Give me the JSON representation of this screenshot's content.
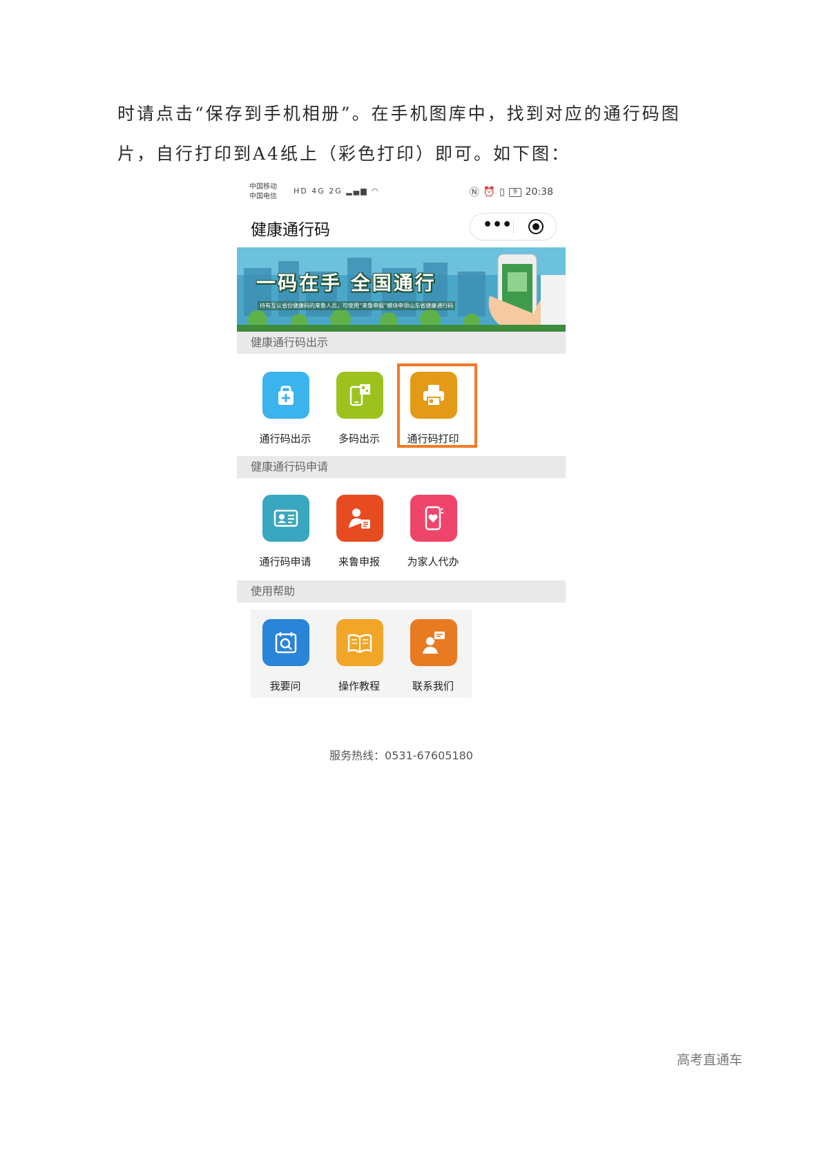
{
  "document": {
    "line1": "时请点击“保存到手机相册”。在手机图库中，找到对应的通行码图",
    "line2": "片，自行打印到A4纸上（彩色打印）即可。如下图："
  },
  "phone": {
    "statusbar": {
      "carrier1": "中国移动",
      "carrier2": "中国电信",
      "network_badges": "HD 4G 2G",
      "battery": "9",
      "time": "20:38"
    },
    "app_title": "健康通行码",
    "banner": {
      "slogan": "一码在手 全国通行",
      "subtext": "持有互认省份健康码的来鲁人员，可使用“来鲁申报”模块申领山东省健康通行码"
    },
    "sections": [
      {
        "title": "健康通行码出示",
        "items": [
          {
            "label": "通行码出示",
            "icon": "medical-kit-icon",
            "color": "#3bb4ee"
          },
          {
            "label": "多码出示",
            "icon": "phone-qr-icon",
            "color": "#9dc21e"
          },
          {
            "label": "通行码打印",
            "icon": "printer-icon",
            "color": "#e39a16",
            "highlighted": true
          }
        ]
      },
      {
        "title": "健康通行码申请",
        "items": [
          {
            "label": "通行码申请",
            "icon": "id-card-icon",
            "color": "#3aa7c0"
          },
          {
            "label": "来鲁申报",
            "icon": "person-form-icon",
            "color": "#e64c1f"
          },
          {
            "label": "为家人代办",
            "icon": "phone-heart-icon",
            "color": "#f0456a"
          }
        ]
      },
      {
        "title": "使用帮助",
        "items": [
          {
            "label": "我要问",
            "icon": "search-calendar-icon",
            "color": "#2a84d8"
          },
          {
            "label": "操作教程",
            "icon": "book-icon",
            "color": "#f2a628"
          },
          {
            "label": "联系我们",
            "icon": "contact-chat-icon",
            "color": "#e87a22"
          }
        ]
      }
    ],
    "hotline": "服务热线：0531-67605180",
    "highlight_color": "#f07a28"
  },
  "watermark": "高考直通车"
}
